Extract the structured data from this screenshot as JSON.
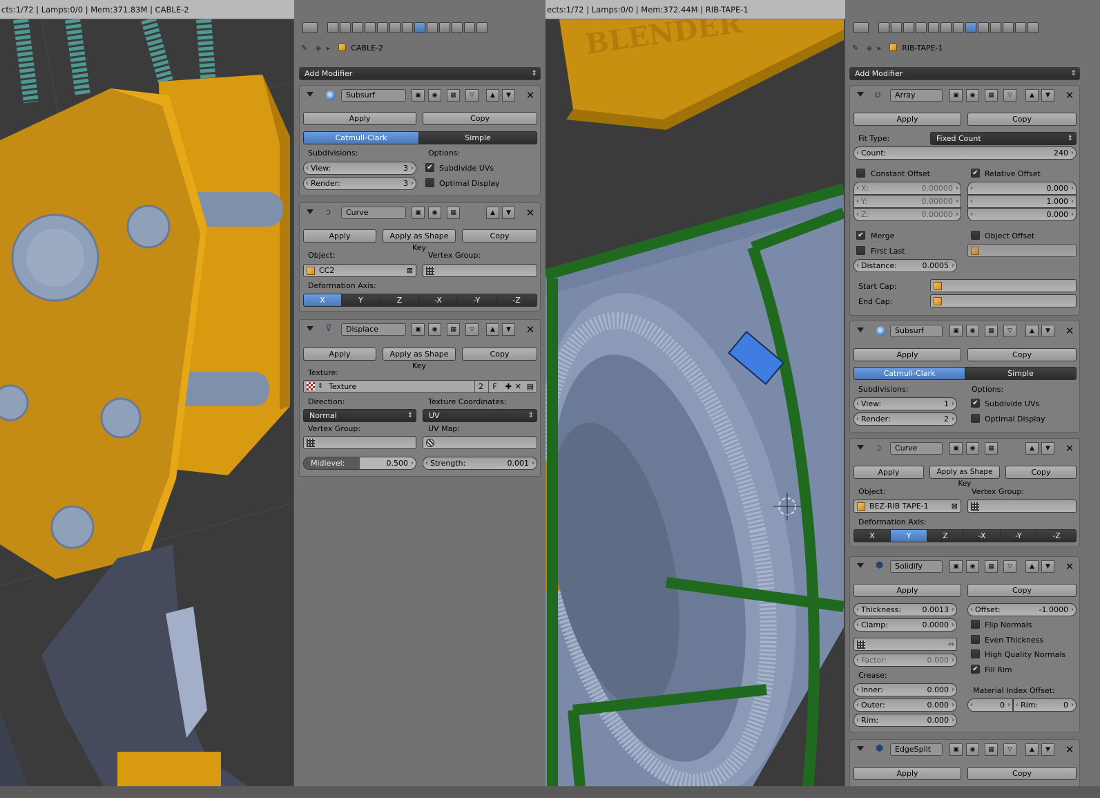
{
  "left": {
    "header": "cts:1/72 | Lamps:0/0 | Mem:371.83M | CABLE-2",
    "object_name": "CABLE-2",
    "add_modifier": "Add Modifier",
    "subsurf": {
      "name": "Subsurf",
      "apply": "Apply",
      "copy": "Copy",
      "mode_a": "Catmull-Clark",
      "mode_b": "Simple",
      "subdivisions_label": "Subdivisions:",
      "options_label": "Options:",
      "view_label": "View:",
      "view_value": "3",
      "render_label": "Render:",
      "render_value": "3",
      "subdivide_uvs": "Subdivide UVs",
      "optimal_display": "Optimal Display"
    },
    "curve": {
      "name": "Curve",
      "apply": "Apply",
      "apply_shape": "Apply as Shape Key",
      "copy": "Copy",
      "object_label": "Object:",
      "object_value": "CC2",
      "vgroup_label": "Vertex Group:",
      "axis_label": "Deformation Axis:",
      "axes": [
        "X",
        "Y",
        "Z",
        "-X",
        "-Y",
        "-Z"
      ]
    },
    "displace": {
      "name": "Displace",
      "apply": "Apply",
      "apply_shape": "Apply as Shape Key",
      "copy": "Copy",
      "texture_label": "Texture:",
      "texture_value": "Texture",
      "texture_users": "2",
      "texture_fake": "F",
      "direction_label": "Direction:",
      "direction_value": "Normal",
      "texcoords_label": "Texture Coordinates:",
      "texcoords_value": "UV",
      "vgroup_label": "Vertex Group:",
      "uvmap_label": "UV Map:",
      "midlevel_label": "Midlevel:",
      "midlevel_value": "0.500",
      "strength_label": "Strength:",
      "strength_value": "0.001"
    }
  },
  "right": {
    "header": "ects:1/72 | Lamps:0/0 | Mem:372.44M | RIB-TAPE-1",
    "object_name": "RIB-TAPE-1",
    "add_modifier": "Add Modifier",
    "viewport_text": "BLENDER",
    "array": {
      "name": "Array",
      "apply": "Apply",
      "copy": "Copy",
      "fit_type_label": "Fit Type:",
      "fit_type_value": "Fixed Count",
      "count_label": "Count:",
      "count_value": "240",
      "constant_offset": "Constant Offset",
      "relative_offset": "Relative Offset",
      "cx_label": "X:",
      "cx": "0.00000",
      "cy_label": "Y:",
      "cy": "0.00000",
      "cz_label": "Z:",
      "cz": "0.00000",
      "rx": "0.000",
      "ry": "1.000",
      "rz": "0.000",
      "merge": "Merge",
      "first_last": "First Last",
      "object_offset": "Object Offset",
      "distance_label": "Distance:",
      "distance_value": "0.0005",
      "start_cap": "Start Cap:",
      "end_cap": "End Cap:"
    },
    "subsurf": {
      "name": "Subsurf",
      "apply": "Apply",
      "copy": "Copy",
      "mode_a": "Catmull-Clark",
      "mode_b": "Simple",
      "subdivisions_label": "Subdivisions:",
      "options_label": "Options:",
      "view_label": "View:",
      "view_value": "1",
      "render_label": "Render:",
      "render_value": "2",
      "subdivide_uvs": "Subdivide UVs",
      "optimal_display": "Optimal Display"
    },
    "curve": {
      "name": "Curve",
      "apply": "Apply",
      "apply_shape": "Apply as Shape Key",
      "copy": "Copy",
      "object_label": "Object:",
      "object_value": "BEZ-RIB TAPE-1",
      "vgroup_label": "Vertex Group:",
      "axis_label": "Deformation Axis:",
      "axes": [
        "X",
        "Y",
        "Z",
        "-X",
        "-Y",
        "-Z"
      ]
    },
    "solidify": {
      "name": "Solidify",
      "apply": "Apply",
      "copy": "Copy",
      "thickness_label": "Thickness:",
      "thickness_value": "0.0013",
      "offset_label": "Offset:",
      "offset_value": "-1.0000",
      "clamp_label": "Clamp:",
      "clamp_value": "0.0000",
      "flip_normals": "Flip Normals",
      "even_thickness": "Even Thickness",
      "hq_normals": "High Quality Normals",
      "fill_rim": "Fill Rim",
      "factor_label": "Factor:",
      "factor_value": "0.000",
      "crease_label": "Crease:",
      "inner_label": "Inner:",
      "inner_value": "0.000",
      "outer_label": "Outer:",
      "outer_value": "0.000",
      "rim_label": "Rim:",
      "rim_value": "0.000",
      "mat_offset_label": "Material Index Offset:",
      "mat_value": "0",
      "mat_rim_label": "Rim:",
      "mat_rim_value": "0"
    },
    "edgesplit": {
      "name": "EdgeSplit",
      "apply": "Apply",
      "copy": "Copy"
    }
  },
  "colors": {
    "accent": "#5680c2",
    "panel": "#727272",
    "module": "#7e7e7e",
    "yellow": "#e2a10f",
    "metal": "#8797b0",
    "green": "#1f6a1f"
  }
}
